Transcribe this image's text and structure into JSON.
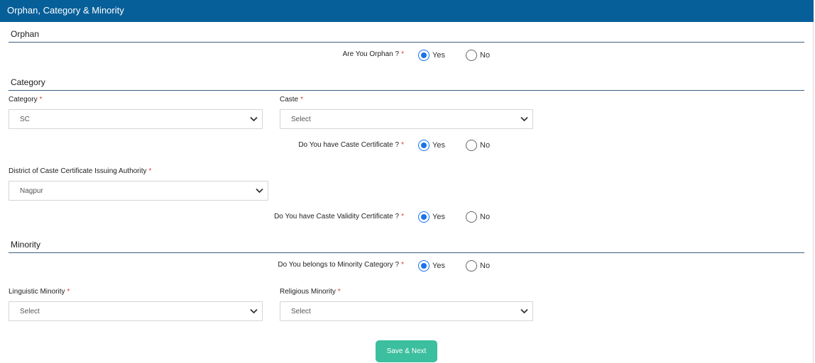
{
  "header": {
    "title": "Orphan, Category & Minority"
  },
  "required_marker": "*",
  "radio_labels": {
    "yes": "Yes",
    "no": "No"
  },
  "orphan": {
    "section_title": "Orphan",
    "question": "Are You Orphan ?",
    "selected": "Yes"
  },
  "category": {
    "section_title": "Category",
    "category_label": "Category",
    "category_value": "SC",
    "caste_label": "Caste",
    "caste_value": "Select",
    "caste_certificate_question": "Do You have Caste Certificate ?",
    "caste_certificate_selected": "Yes",
    "district_label": "District of Caste Certificate Issuing Authority",
    "district_value": "Nagpur",
    "validity_question": "Do You have Caste Validity Certificate ?",
    "validity_selected": "Yes"
  },
  "minority": {
    "section_title": "Minority",
    "question": "Do You belongs to Minority Category ?",
    "selected": "Yes",
    "linguistic_label": "Linguistic Minority",
    "linguistic_value": "Select",
    "religious_label": "Religious Minority",
    "religious_value": "Select"
  },
  "actions": {
    "save_next_label": "Save & Next"
  },
  "colors": {
    "header_bg": "#075f99",
    "accent_radio": "#1a73e8",
    "button_bg": "#3cbf9e",
    "required": "#e0393e"
  }
}
